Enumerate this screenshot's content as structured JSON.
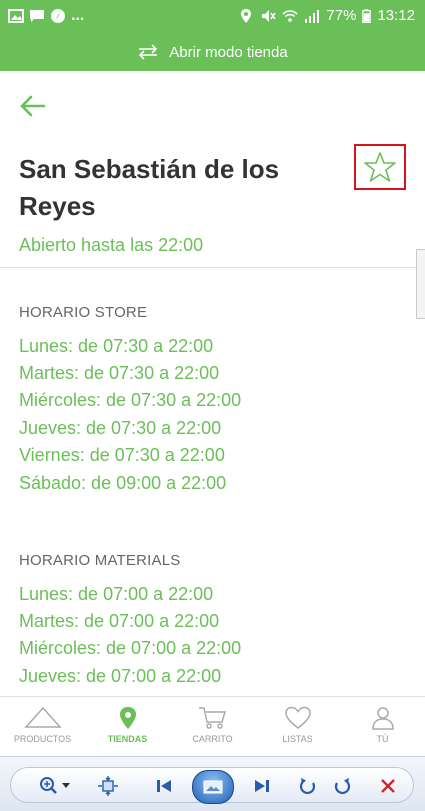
{
  "status_bar": {
    "battery": "77%",
    "time": "13:12",
    "dots": "..."
  },
  "store_bar": {
    "label": "Abrir modo tienda",
    "icon": "swap-arrows-icon"
  },
  "store": {
    "name": "San Sebastián de los Reyes",
    "open_status": "Abierto hasta las 22:00"
  },
  "schedules": [
    {
      "title": "HORARIO STORE",
      "lines": [
        "Lunes: de 07:30 a 22:00",
        "Martes: de 07:30 a 22:00",
        "Miércoles: de 07:30 a 22:00",
        "Jueves: de 07:30 a 22:00",
        "Viernes: de 07:30 a 22:00",
        "Sábado: de 09:00 a 22:00"
      ]
    },
    {
      "title": "HORARIO MATERIALS",
      "lines": [
        "Lunes: de 07:00 a 22:00",
        "Martes: de 07:00 a 22:00",
        "Miércoles: de 07:00 a 22:00",
        "Jueves: de 07:00 a 22:00"
      ]
    }
  ],
  "nav": [
    {
      "label": "PRODUCTOS",
      "icon": "triangle-icon",
      "active": false
    },
    {
      "label": "TIENDAS",
      "icon": "map-pin-icon",
      "active": true
    },
    {
      "label": "CARRITO",
      "icon": "cart-icon",
      "active": false
    },
    {
      "label": "LISTAS",
      "icon": "heart-icon",
      "active": false
    },
    {
      "label": "TÚ",
      "icon": "user-icon",
      "active": false
    }
  ],
  "colors": {
    "accent": "#6bbf59",
    "highlight_border": "#d8141b",
    "title": "#333333"
  }
}
